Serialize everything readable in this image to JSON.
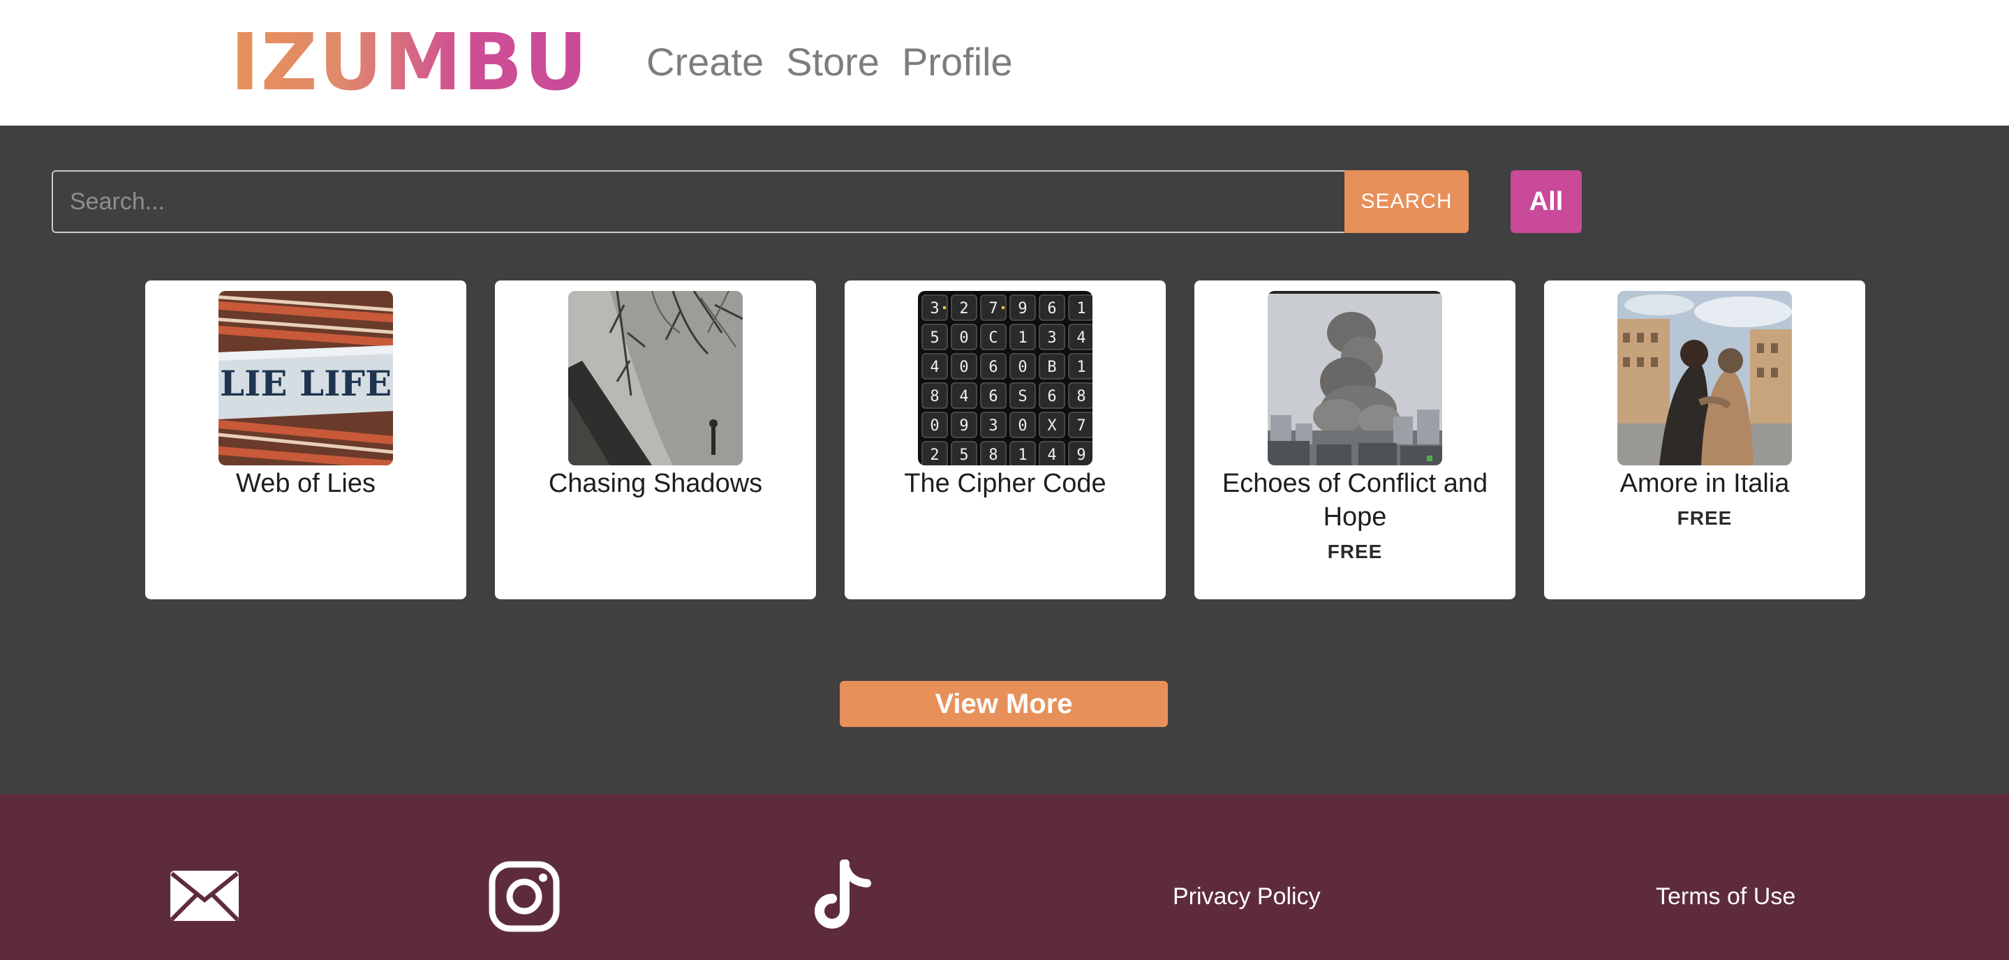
{
  "header": {
    "logo_text": "IZUMBU",
    "nav": [
      {
        "label": "Create"
      },
      {
        "label": "Store"
      },
      {
        "label": "Profile"
      }
    ]
  },
  "search": {
    "placeholder": "Search...",
    "button_label": "SEARCH",
    "filter_label": "All"
  },
  "cards": [
    {
      "title": "Web of Lies",
      "price": "",
      "thumb": "text-stone-image"
    },
    {
      "title": "Chasing Shadows",
      "price": "",
      "thumb": "reflection-image"
    },
    {
      "title": "The Cipher Code",
      "price": "",
      "thumb": "keyboard-keys-image"
    },
    {
      "title": "Echoes of Conflict and Hope",
      "price": "FREE",
      "thumb": "explosion-city-image"
    },
    {
      "title": "Amore in Italia",
      "price": "FREE",
      "thumb": "couple-street-image"
    }
  ],
  "view_more_label": "View More",
  "footer": {
    "icons": [
      "mail-icon",
      "instagram-icon",
      "tiktok-icon"
    ],
    "privacy_label": "Privacy Policy",
    "terms_label": "Terms of Use"
  },
  "colors": {
    "accent_orange": "#e8905a",
    "accent_pink": "#c94a98",
    "background": "#404040",
    "footer": "#5e2b3e"
  }
}
